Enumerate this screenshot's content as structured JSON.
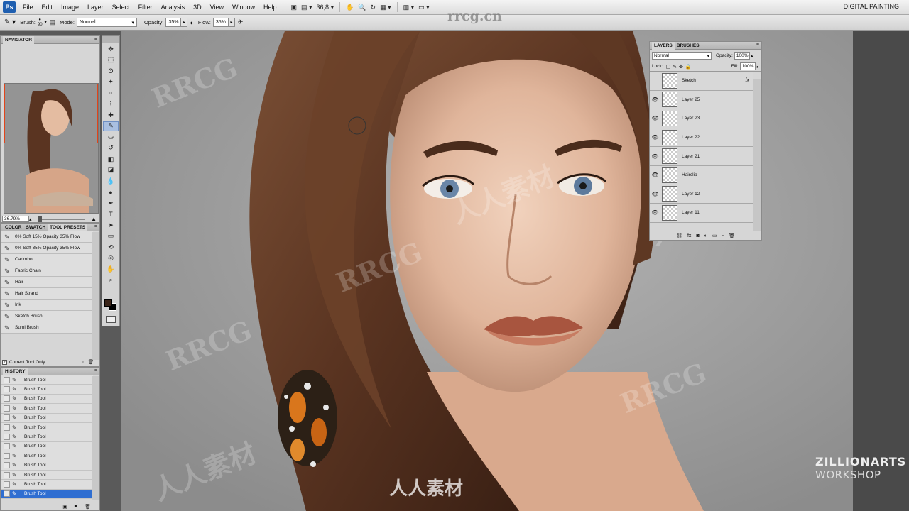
{
  "app": {
    "logo": "Ps",
    "menu": [
      "File",
      "Edit",
      "Image",
      "Layer",
      "Select",
      "Filter",
      "Analysis",
      "3D",
      "View",
      "Window",
      "Help"
    ],
    "zoom_control": "36,8",
    "workspace": "DIGITAL PAINTING"
  },
  "options": {
    "brush_label": "Brush:",
    "brush_size": "90",
    "mode_label": "Mode:",
    "mode_value": "Normal",
    "opacity_label": "Opacity:",
    "opacity_value": "35%",
    "flow_label": "Flow:",
    "flow_value": "35%"
  },
  "navigator": {
    "title": "NAVIGATOR",
    "zoom": "36.79%"
  },
  "presets": {
    "tabs": [
      "COLOR",
      "SWATCH",
      "TOOL PRESETS"
    ],
    "items": [
      "0% Soft 15% Opacity 35% Flow",
      "0% Soft 35% Opacity 35% Flow",
      "Carimbo",
      "Fabric Chain",
      "Hair",
      "Hair Strand",
      "Ink",
      "Sketch Brush",
      "Sumi Brush"
    ],
    "current_only": "Current Tool Only"
  },
  "history": {
    "title": "HISTORY",
    "items": [
      "Brush Tool",
      "Brush Tool",
      "Brush Tool",
      "Brush Tool",
      "Brush Tool",
      "Brush Tool",
      "Brush Tool",
      "Brush Tool",
      "Brush Tool",
      "Brush Tool",
      "Brush Tool",
      "Brush Tool",
      "Brush Tool"
    ]
  },
  "layers": {
    "tabs": [
      "LAYERS",
      "BRUSHES"
    ],
    "blend_mode": "Normal",
    "opacity_label": "Opacity:",
    "opacity_value": "100%",
    "lock_label": "Lock:",
    "fill_label": "Fill:",
    "fill_value": "100%",
    "items": [
      {
        "name": "Sketch",
        "visible": false,
        "fx": "fx"
      },
      {
        "name": "Layer 25",
        "visible": true
      },
      {
        "name": "Layer 23",
        "visible": true
      },
      {
        "name": "Layer 22",
        "visible": true
      },
      {
        "name": "Layer 21",
        "visible": true
      },
      {
        "name": "Hairclip",
        "visible": true
      },
      {
        "name": "Layer 12",
        "visible": true
      },
      {
        "name": "Layer 11",
        "visible": true
      }
    ]
  },
  "colors": {
    "foreground": "#3a2418",
    "background": "#000000",
    "selection": "#2f6ed1"
  },
  "watermarks": {
    "url": "rrcg.cn",
    "mark": "RRCG",
    "cn": "人人素材",
    "brand_line1": "ZILLIONARTS",
    "brand_line2": "WORKSHOP"
  }
}
